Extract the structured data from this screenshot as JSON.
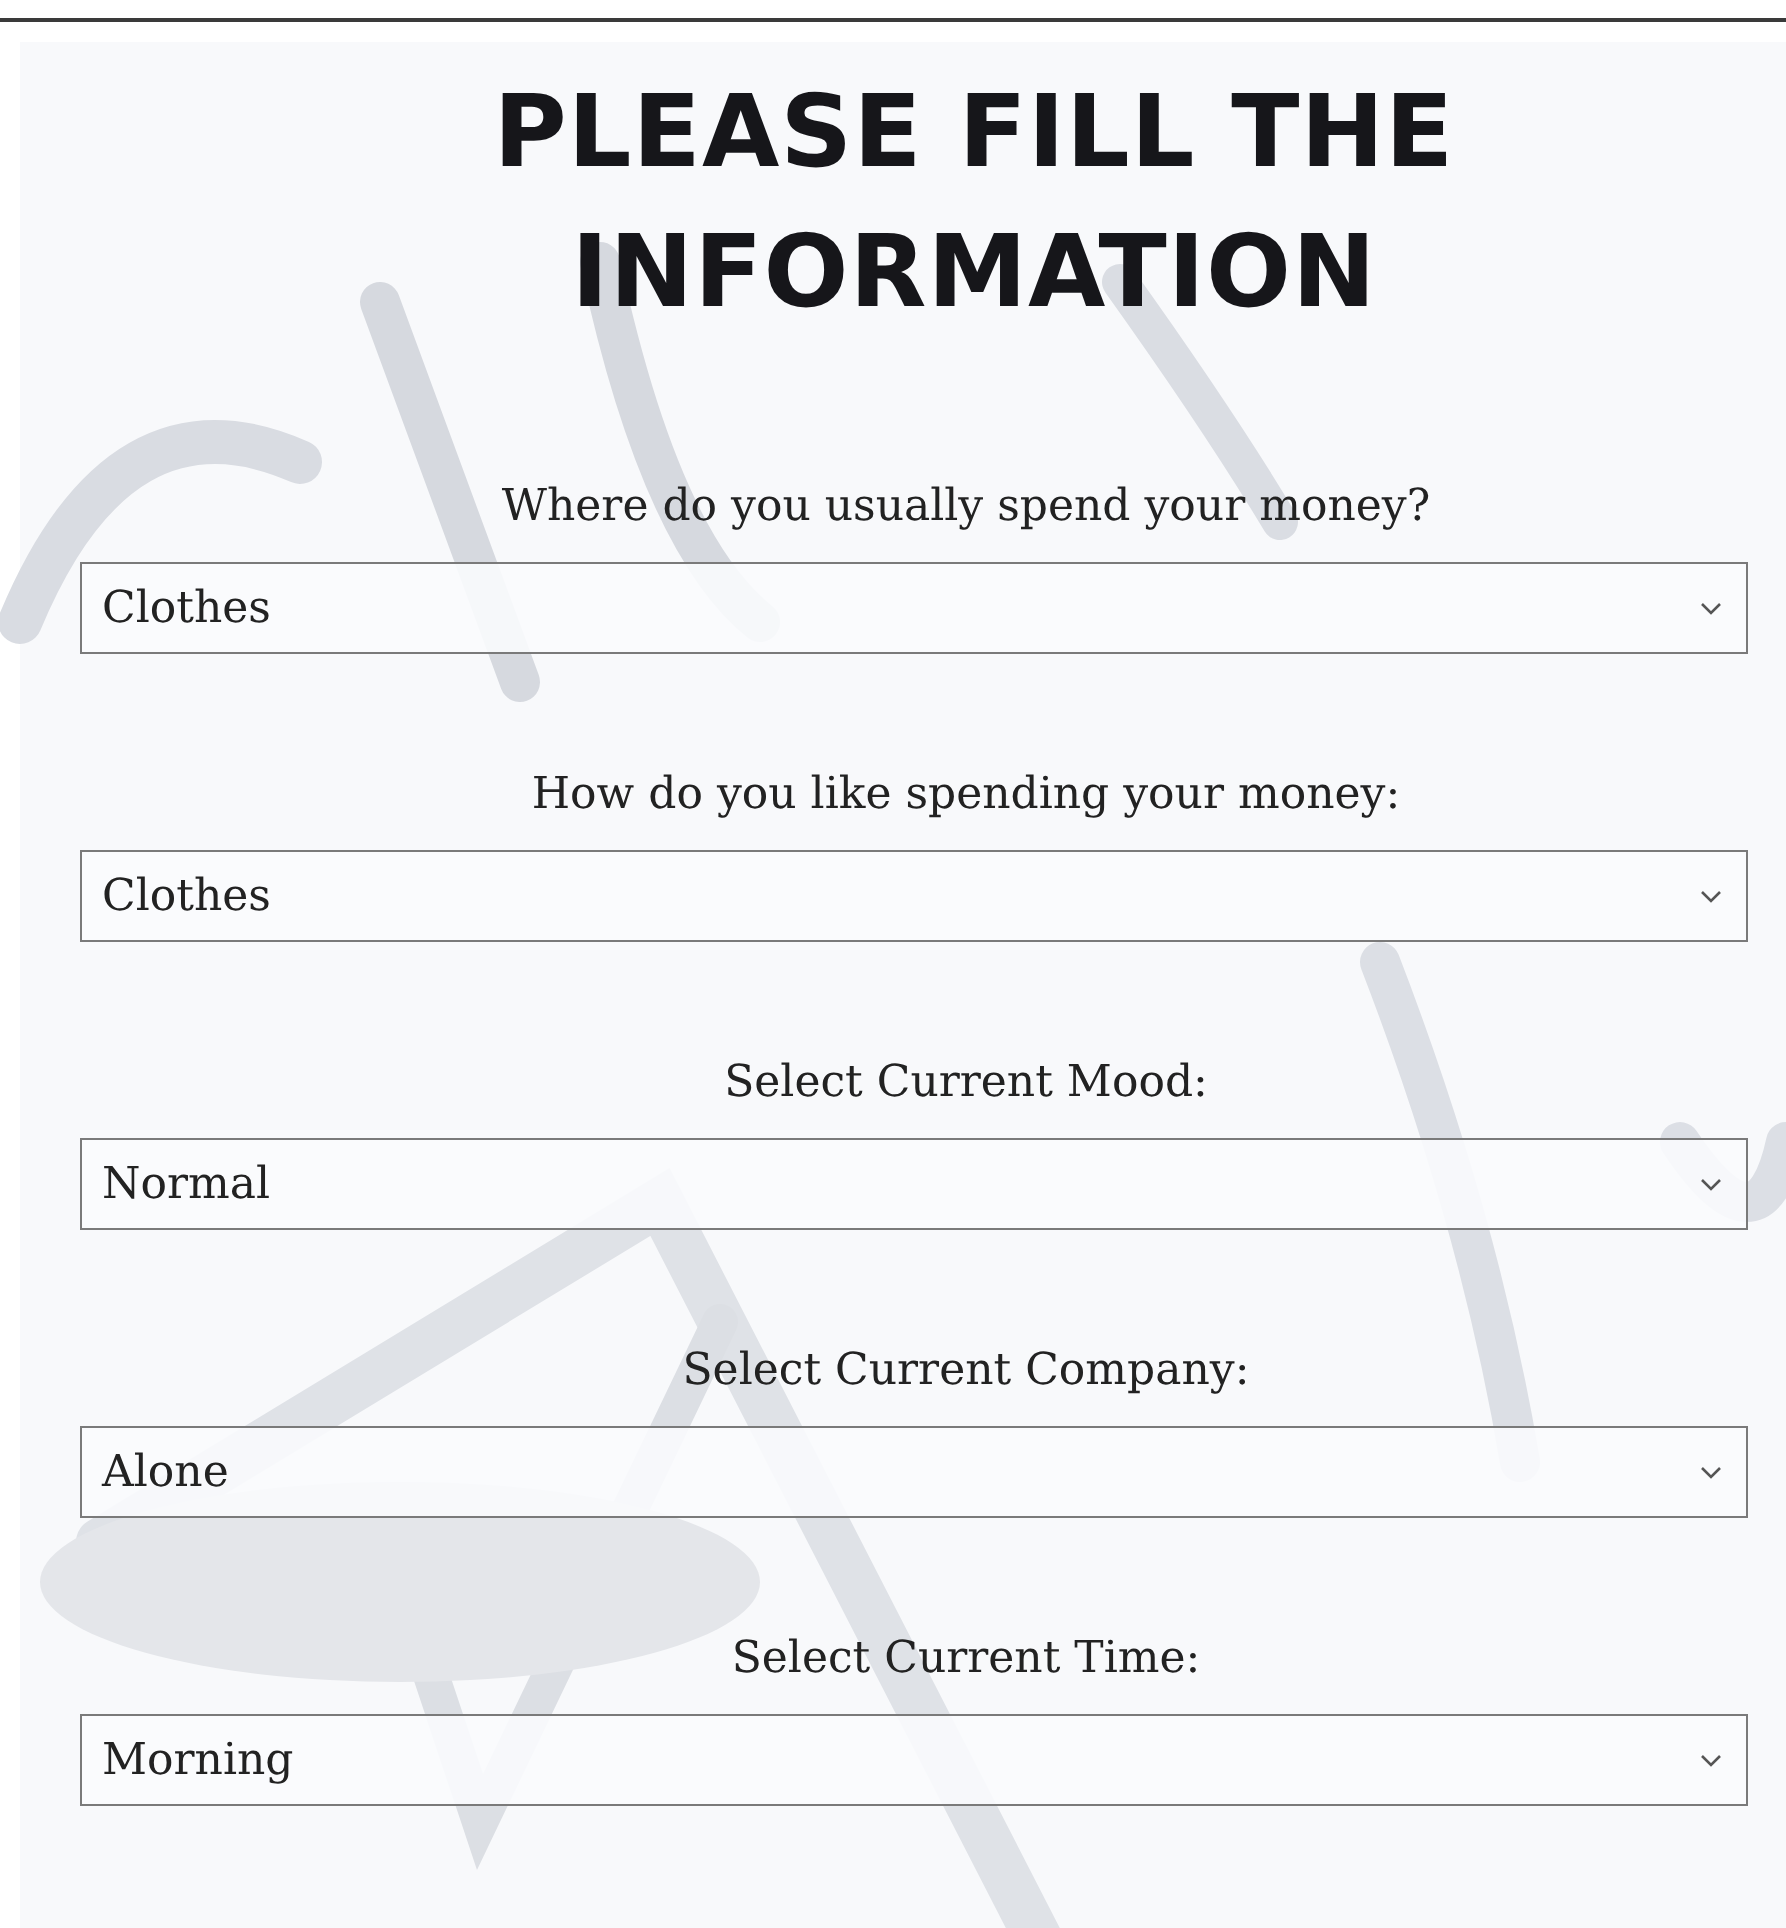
{
  "title": "PLEASE FILL THE INFORMATION",
  "questions": [
    {
      "label": "Where do you usually spend your money?",
      "value": "Clothes"
    },
    {
      "label": "How do you like spending your money:",
      "value": "Clothes"
    },
    {
      "label": "Select Current Mood:",
      "value": "Normal"
    },
    {
      "label": "Select Current Company:",
      "value": "Alone"
    },
    {
      "label": "Select Current Time:",
      "value": "Morning"
    }
  ]
}
